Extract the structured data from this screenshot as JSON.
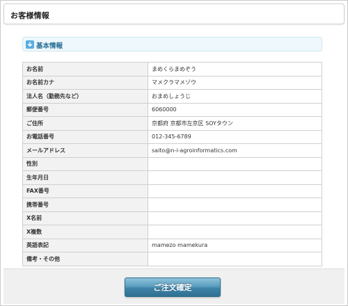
{
  "page": {
    "title": "お客様情報"
  },
  "section": {
    "title": "基本情報",
    "icon": "download-arrow-icon"
  },
  "rows": [
    {
      "label": "お名前",
      "value": "まめくらまめぞう"
    },
    {
      "label": "お名前カナ",
      "value": "マメクラマメゾウ"
    },
    {
      "label": "法人名（勤務先など）",
      "value": "おまめしょうじ"
    },
    {
      "label": "郵便番号",
      "value": "6060000"
    },
    {
      "label": "ご住所",
      "value": "京都府 京都市左京区 SOYタウン"
    },
    {
      "label": "お電話番号",
      "value": "012-345-6789"
    },
    {
      "label": "メールアドレス",
      "value": "saito@n-i-agroinformatics.com"
    },
    {
      "label": "性別",
      "value": ""
    },
    {
      "label": "生年月日",
      "value": ""
    },
    {
      "label": "FAX番号",
      "value": ""
    },
    {
      "label": "携帯番号",
      "value": ""
    },
    {
      "label": "X名前",
      "value": ""
    },
    {
      "label": "X複数",
      "value": ""
    },
    {
      "label": "英語表記",
      "value": "mamezo mamekura"
    },
    {
      "label": "備考・その他",
      "value": ""
    }
  ],
  "footer": {
    "confirm_label": "ご注文確定"
  },
  "colors": {
    "section_title": "#2a6f96",
    "button": "#3f84a8",
    "header_cell_bg": "#f2f2f2"
  }
}
